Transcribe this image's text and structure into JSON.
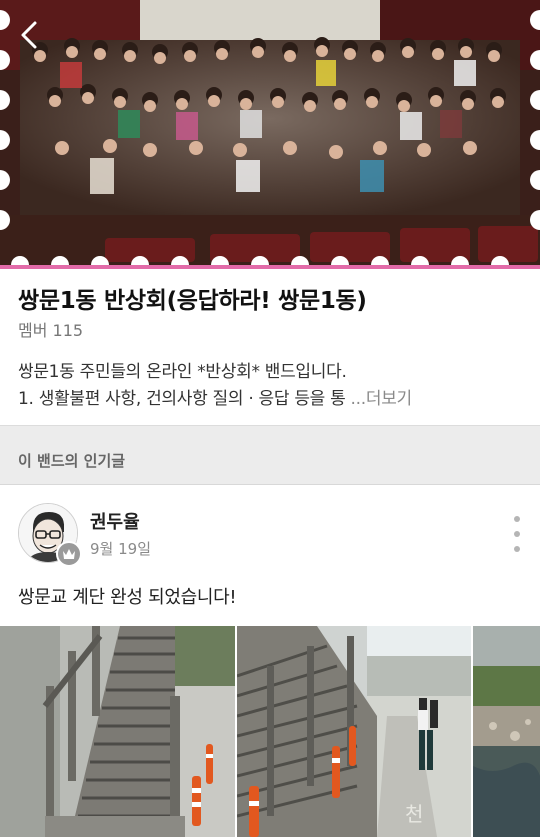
{
  "band": {
    "name": "쌍문1동 반상회(응답하라! 쌍문1동)",
    "member_count": "멤버 115",
    "description_line1": "쌍문1동 주민들의 온라인 *반상회* 밴드입니다.",
    "description_line2": "1. 생활불편 사항, 건의사항 질의 · 응답 등을 통 ",
    "more_label": "...더보기"
  },
  "section": {
    "title": "이 밴드의 인기글"
  },
  "post": {
    "author": "권두율",
    "date": "9월 19일",
    "text": "쌍문교 계단 완성 되었습니다!",
    "photos": [
      "stairs-photo-1",
      "stairs-photo-2",
      "stream-photo-3"
    ]
  },
  "colors": {
    "accent_pink": "#e26aa8",
    "section_bg": "#ececec",
    "crown_badge": "#9a9a9a"
  },
  "icons": {
    "back": "chevron-left-icon",
    "menu": "vertical-dots-icon",
    "badge": "crown-icon"
  }
}
